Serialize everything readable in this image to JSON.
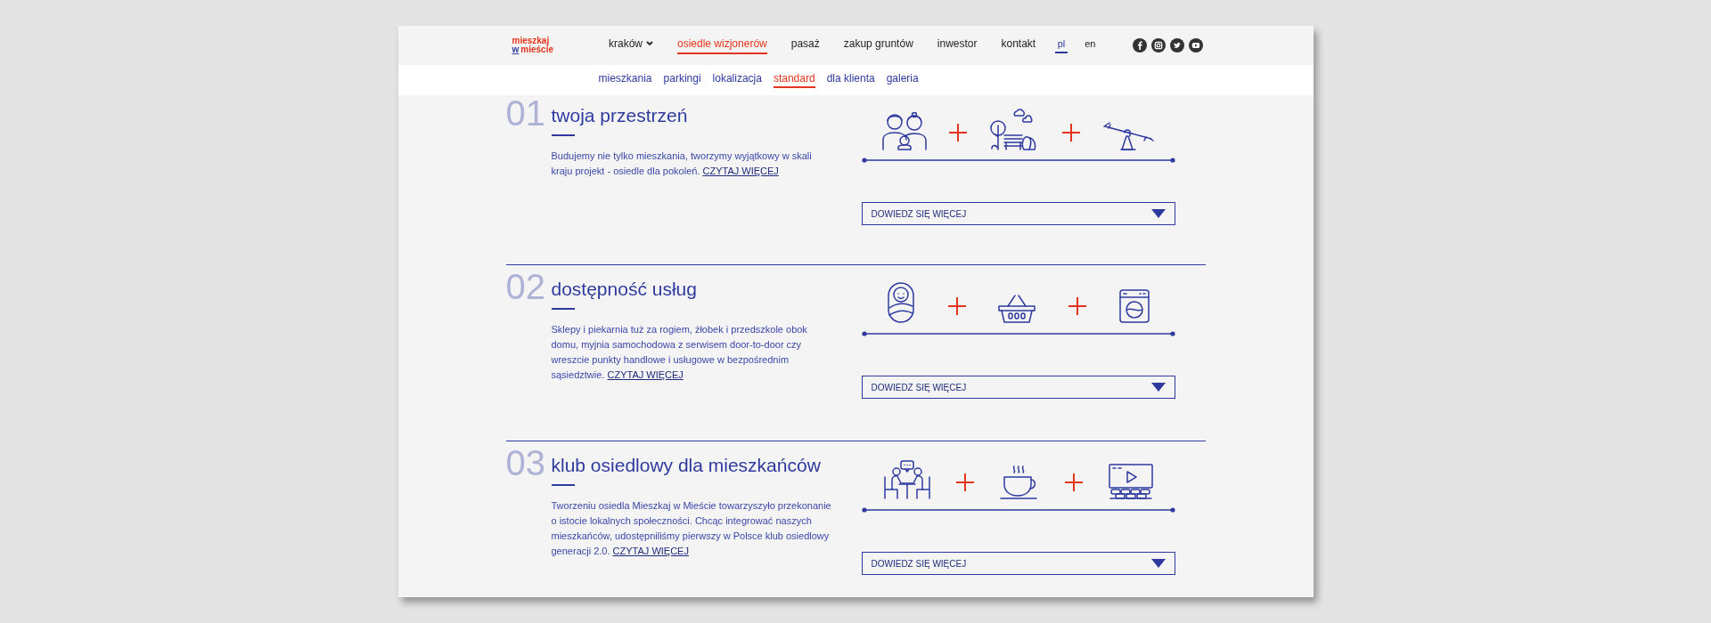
{
  "logo": {
    "top": "mieszkaj",
    "prefix": "w",
    "bottom": "mieście"
  },
  "nav": [
    {
      "label": "kraków",
      "selected": false,
      "has_menu": true
    },
    {
      "label": "osiedle wizjonerów",
      "selected": true,
      "has_menu": false
    },
    {
      "label": "pasaż",
      "selected": false,
      "has_menu": false
    },
    {
      "label": "zakup gruntów",
      "selected": false,
      "has_menu": false
    },
    {
      "label": "inwestor",
      "selected": false,
      "has_menu": false
    },
    {
      "label": "kontakt",
      "selected": false,
      "has_menu": false
    }
  ],
  "languages": [
    {
      "label": "pl",
      "selected": true
    },
    {
      "label": "en",
      "selected": false
    }
  ],
  "subnav": [
    {
      "label": "mieszkania",
      "selected": false
    },
    {
      "label": "parkingi",
      "selected": false
    },
    {
      "label": "lokalizacja",
      "selected": false
    },
    {
      "label": "standard",
      "selected": true
    },
    {
      "label": "dla klienta",
      "selected": false
    },
    {
      "label": "galeria",
      "selected": false
    }
  ],
  "sections": [
    {
      "number": "01",
      "title": "twoja przestrzeń",
      "text": "Budujemy nie tylko mieszkania, tworzymy wyjątkowy w skali kraju projekt - osiedle dla pokoleń.",
      "link": "CZYTAJ WIĘCEJ",
      "icons": [
        {
          "kind": "family"
        },
        {
          "kind": "park"
        },
        {
          "kind": "seesaw"
        }
      ],
      "button": "DOWIEDZ SIĘ WIĘCEJ"
    },
    {
      "number": "02",
      "title": "dostępność usług",
      "text": "Sklepy i piekarnia tuż za rogiem, żłobek i przedszkole obok domu, myjnia samochodowa z serwisem door-to-door czy wreszcie punkty handlowe i usługowe w bezpośrednim sąsiedztwie.",
      "link": "CZYTAJ WIĘCEJ",
      "icons": [
        {
          "kind": "baby"
        },
        {
          "kind": "basket"
        },
        {
          "kind": "washer"
        }
      ],
      "button": "DOWIEDZ SIĘ WIĘCEJ"
    },
    {
      "number": "03",
      "title": "klub osiedlowy dla mieszkańców",
      "text": "Tworzeniu osiedla Mieszkaj w Mieście towarzyszyło przekonanie o istocie lokalnych społeczności. Chcąc integrować naszych mieszkańców, udostępniliśmy pierwszy w Polsce klub osiedlowy generacji 2.0.",
      "link": "CZYTAJ WIĘCEJ",
      "icons": [
        {
          "kind": "meeting"
        },
        {
          "kind": "coffee"
        },
        {
          "kind": "cinema"
        }
      ],
      "button": "DOWIEDZ SIĘ WIĘCEJ"
    }
  ]
}
